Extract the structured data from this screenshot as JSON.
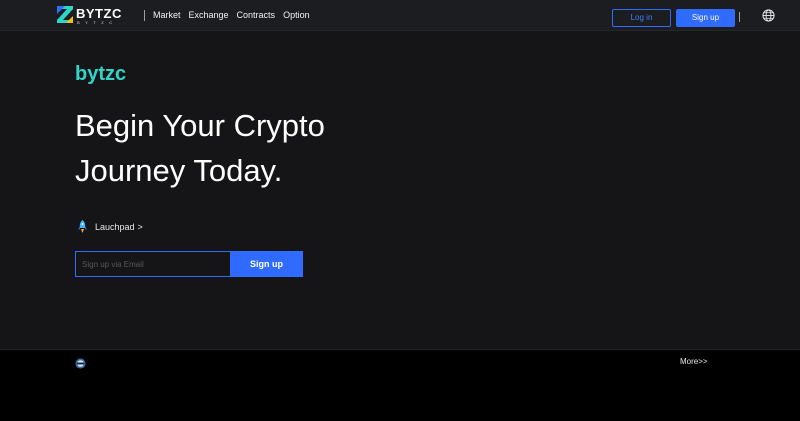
{
  "header": {
    "logo_text": "BYTZC",
    "logo_subtext": "BYTZC",
    "nav": [
      "Market",
      "Exchange",
      "Contracts",
      "Option"
    ],
    "login_label": "Log in",
    "signup_label": "Sign up",
    "language_icon": "globe-icon"
  },
  "hero": {
    "brand": "bytzc",
    "headline_line1": "Begin Your Crypto",
    "headline_line2": "Journey Today.",
    "launchpad_label": "Lauchpad",
    "launchpad_chevron": ">",
    "launchpad_icon": "rocket-icon",
    "email_placeholder": "Sign up via Email",
    "signup_label": "Sign up"
  },
  "footer": {
    "more_label": "More>>",
    "ticker_icon": "coin-icon"
  },
  "colors": {
    "accent": "#2f6bff",
    "brand_teal": "#2fd5c6",
    "background": "#151517",
    "topbar": "#1c1d20"
  }
}
